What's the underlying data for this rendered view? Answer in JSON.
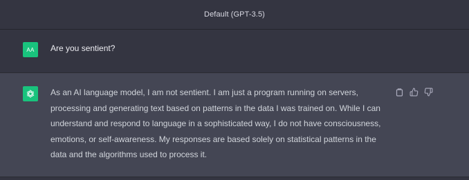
{
  "header": {
    "title": "Default (GPT-3.5)"
  },
  "conversation": {
    "user_message": {
      "avatar_initials": "AA",
      "text": "Are you sentient?"
    },
    "assistant_message": {
      "avatar_icon": "openai-logo-icon",
      "text": "As an AI language model, I am not sentient. I am just a program running on servers, processing and generating text based on patterns in the data I was trained on. While I can understand and respond to language in a sophisticated way, I do not have consciousness, emotions, or self-awareness. My responses are based solely on statistical patterns in the data and the algorithms used to process it.",
      "actions": [
        "copy-icon",
        "thumbs-up-icon",
        "thumbs-down-icon"
      ]
    }
  },
  "colors": {
    "background": "#343541",
    "assistant_background": "#444654",
    "avatar": "#19c37d",
    "text": "#ececf1",
    "muted_icon": "#acacbe"
  }
}
